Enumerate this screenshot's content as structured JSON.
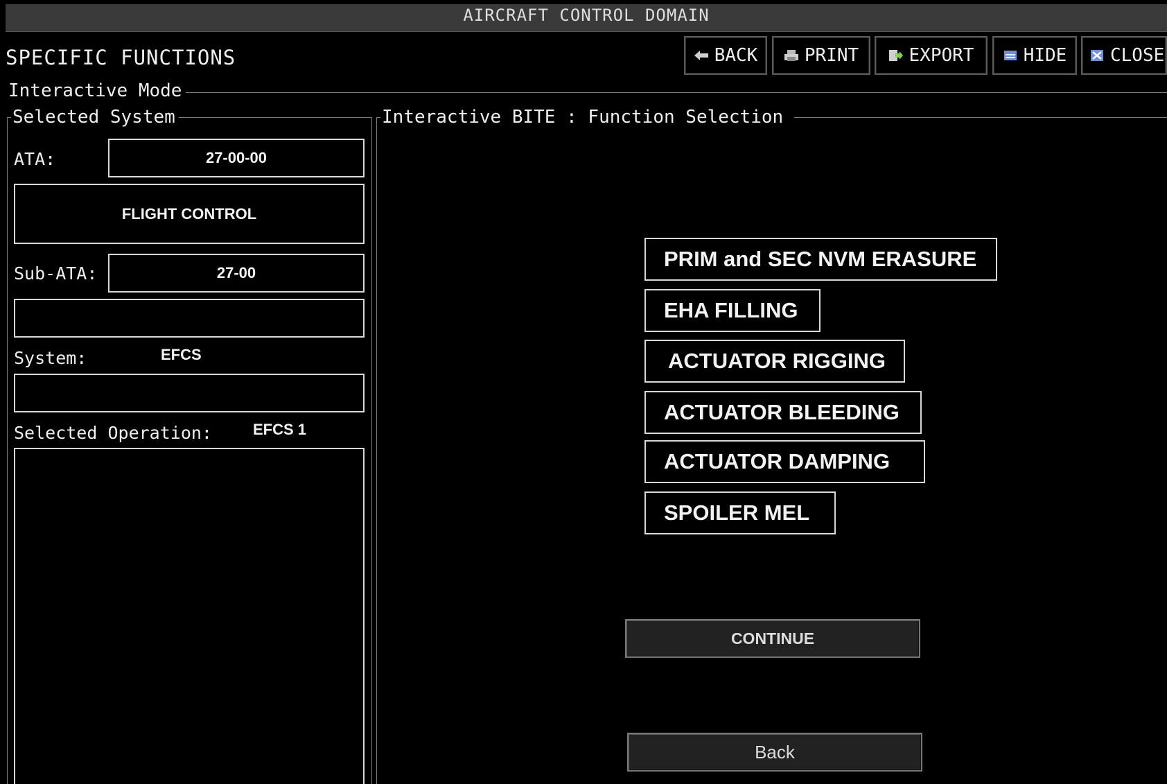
{
  "window": {
    "title": "AIRCRAFT CONTROL DOMAIN"
  },
  "header": {
    "page_title": "SPECIFIC FUNCTIONS"
  },
  "toolbar": {
    "back_label": "BACK",
    "print_label": "PRINT",
    "export_label": "EXPORT",
    "hide_label": "HIDE",
    "close_label": "CLOSE"
  },
  "mode": {
    "legend": "Interactive Mode"
  },
  "selected_system": {
    "legend": "Selected System",
    "ata_label": "ATA:",
    "ata_value": "27-00-00",
    "ata_title": "FLIGHT CONTROL",
    "sub_ata_label": "Sub-ATA:",
    "sub_ata_value": "27-00",
    "sub_ata_title": "",
    "system_label": "System:",
    "system_value": "EFCS",
    "system_field_value": "",
    "operation_label": "Selected Operation:",
    "operation_value": "EFCS 1",
    "operation_details": ""
  },
  "bite": {
    "legend": "Interactive BITE : Function Selection",
    "functions": [
      "PRIM and SEC NVM ERASURE",
      "EHA FILLING",
      "ACTUATOR RIGGING",
      "ACTUATOR BLEEDING",
      "ACTUATOR DAMPING",
      "SPOILER MEL"
    ],
    "continue_label": "CONTINUE",
    "back_label": "Back"
  },
  "colors": {
    "background": "#000000",
    "titlebar": "#3a3a3a",
    "border": "#d8d8d8"
  }
}
